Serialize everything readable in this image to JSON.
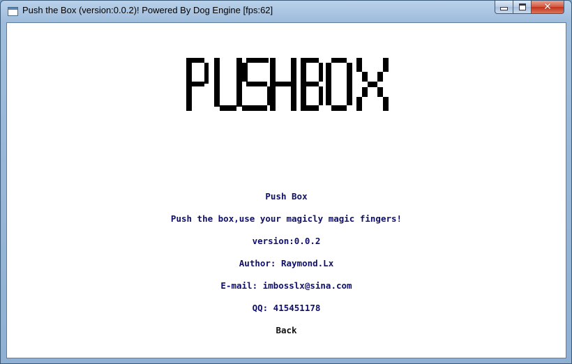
{
  "window": {
    "title": "Push the Box (version:0.0.2)! Powered By Dog Engine [fps:62]",
    "controls": [
      "minimize",
      "maximize",
      "close"
    ]
  },
  "logo": {
    "text": "PUSHBOX",
    "color": "#000000"
  },
  "about": {
    "name": "Push Box",
    "tagline": "Push the box,use your magicly magic fingers!",
    "version": "version:0.0.2",
    "author": "Author: Raymond.Lx",
    "email": "E-mail: imbosslx@sina.com",
    "qq": "QQ: 415451178",
    "back_label": "Back"
  },
  "colors": {
    "text": "#0f0f6b",
    "back": "#111111",
    "background": "#ffffff"
  }
}
